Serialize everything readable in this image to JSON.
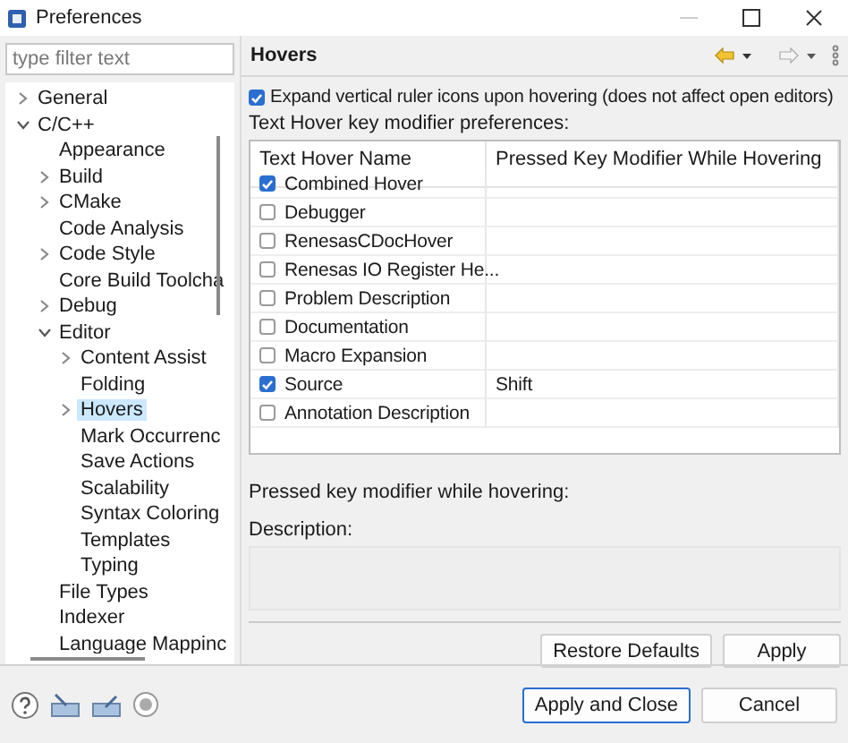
{
  "window": {
    "title": "Preferences"
  },
  "filter": {
    "placeholder": "type filter text"
  },
  "tree": [
    {
      "label": "General",
      "expanded": false,
      "selected": false
    },
    {
      "label": "C/C++",
      "expanded": true,
      "selected": false,
      "children": [
        {
          "label": "Appearance",
          "selected": false
        },
        {
          "label": "Build",
          "expanded": false,
          "selected": false
        },
        {
          "label": "CMake",
          "expanded": false,
          "selected": false
        },
        {
          "label": "Code Analysis",
          "selected": false
        },
        {
          "label": "Code Style",
          "expanded": false,
          "selected": false
        },
        {
          "label": "Core Build Toolcha",
          "selected": false
        },
        {
          "label": "Debug",
          "expanded": false,
          "selected": false
        },
        {
          "label": "Editor",
          "expanded": true,
          "selected": false,
          "children": [
            {
              "label": "Content Assist",
              "expanded": false,
              "selected": false
            },
            {
              "label": "Folding",
              "selected": false
            },
            {
              "label": "Hovers",
              "expanded": false,
              "selected": true
            },
            {
              "label": "Mark Occurrenc",
              "selected": false
            },
            {
              "label": "Save Actions",
              "selected": false
            },
            {
              "label": "Scalability",
              "selected": false
            },
            {
              "label": "Syntax Coloring",
              "selected": false
            },
            {
              "label": "Templates",
              "selected": false
            },
            {
              "label": "Typing",
              "selected": false
            }
          ]
        },
        {
          "label": "File Types",
          "selected": false
        },
        {
          "label": "Indexer",
          "selected": false
        },
        {
          "label": "Language Mappinc",
          "selected": false
        }
      ]
    }
  ],
  "page": {
    "title": "Hovers",
    "expand_option": {
      "label": "Expand vertical ruler icons upon hovering (does not affect open editors)",
      "checked": true
    },
    "table_label": "Text Hover key modifier preferences:",
    "columns": [
      "Text Hover Name",
      "Pressed Key Modifier While Hovering"
    ],
    "rows": [
      {
        "name": "Combined Hover",
        "checked": true,
        "modifier": ""
      },
      {
        "name": "Debugger",
        "checked": false,
        "modifier": ""
      },
      {
        "name": "RenesasCDocHover",
        "checked": false,
        "modifier": ""
      },
      {
        "name": "Renesas IO Register He...",
        "checked": false,
        "modifier": ""
      },
      {
        "name": "Problem Description",
        "checked": false,
        "modifier": ""
      },
      {
        "name": "Documentation",
        "checked": false,
        "modifier": ""
      },
      {
        "name": "Macro Expansion",
        "checked": false,
        "modifier": ""
      },
      {
        "name": "Source",
        "checked": true,
        "modifier": "Shift"
      },
      {
        "name": "Annotation Description",
        "checked": false,
        "modifier": ""
      }
    ],
    "modifier_label": "Pressed key modifier while hovering:",
    "description_label": "Description:",
    "buttons": [
      "Restore Defaults",
      "Apply"
    ]
  },
  "dialog_buttons": [
    {
      "label": "Apply and Close",
      "default": true
    },
    {
      "label": "Cancel",
      "default": false
    }
  ]
}
